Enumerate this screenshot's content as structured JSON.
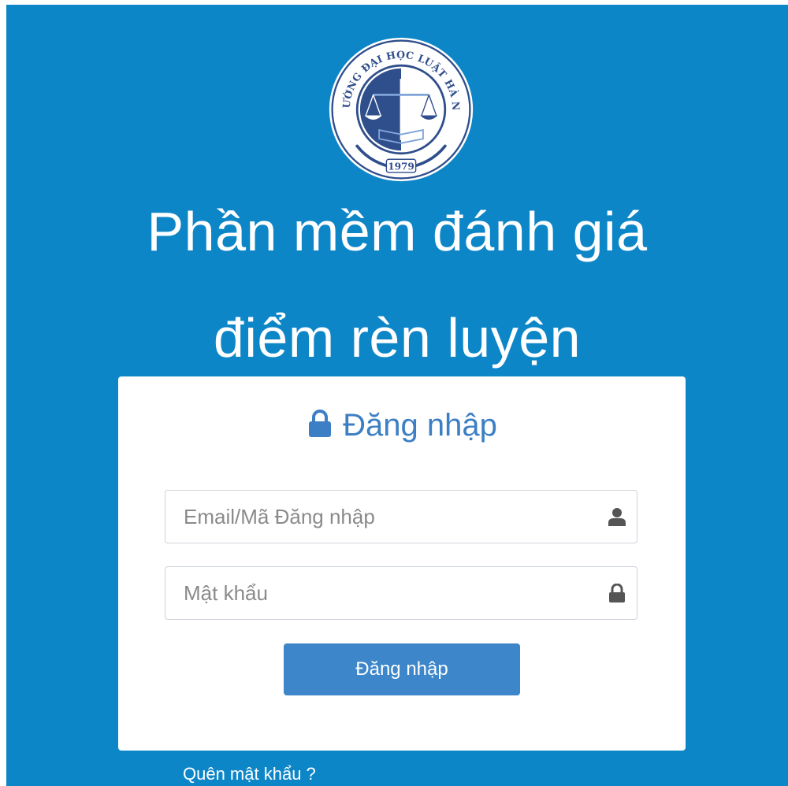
{
  "logo": {
    "ring_text": "TRƯỜNG ĐẠI HỌC LUẬT HÀ NỘI",
    "year": "1979",
    "icon": "scales-of-justice-seal"
  },
  "app_title": {
    "line1": "Phần mềm đánh giá",
    "line2": "điểm rèn luyện"
  },
  "login": {
    "heading": "Đăng nhập",
    "heading_icon": "lock-icon",
    "username": {
      "placeholder": "Email/Mã Đăng nhập",
      "value": "",
      "icon": "user-icon"
    },
    "password": {
      "placeholder": "Mật khẩu",
      "value": "",
      "icon": "lock-icon"
    },
    "submit_label": "Đăng nhập",
    "forgot_label": "Quên mật khẩu ?"
  },
  "colors": {
    "background": "#0d86c8",
    "accent": "#3c7fc4",
    "button": "#3d86c9",
    "seal_dark": "#2f4e8c"
  }
}
